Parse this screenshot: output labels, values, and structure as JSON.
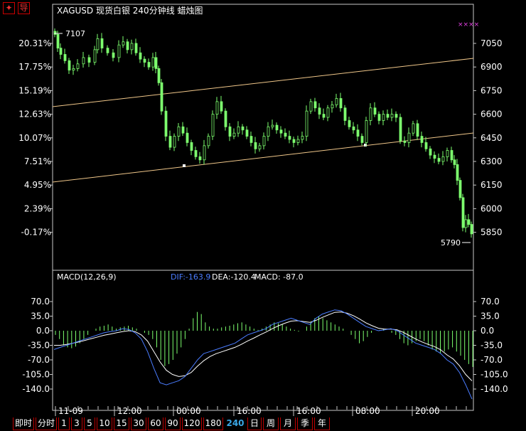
{
  "toolbar": {
    "btn1_glyph": "✦",
    "btn2_label": "导"
  },
  "header": {
    "title": "XAGUSD 现货白银 240分钟线  蜡烛图"
  },
  "main_chart": {
    "left_ticks": [
      "20.31%",
      "17.75%",
      "15.19%",
      "12.63%",
      "10.07%",
      "7.51%",
      "4.95%",
      "2.39%",
      "-0.17%"
    ],
    "right_ticks": [
      "7050",
      "6900",
      "6750",
      "6600",
      "6450",
      "6300",
      "6150",
      "6000",
      "5850"
    ],
    "high_label": "7107",
    "low_label": "5790",
    "corner_mark": "××××",
    "colors": {
      "candle": "#7dff6e",
      "channel": "#f0c78a",
      "grid": "#ffffff"
    }
  },
  "macd": {
    "title": "MACD(12,26,9)",
    "dif_label": "DIF:-163.9",
    "dea_label": "DEA:-120.4",
    "macd_label": "MACD: -87.0",
    "ticks": [
      "70.0",
      "35.0",
      "0.0",
      "-35.0",
      "-70.0",
      "-105.0",
      "-140.0"
    ],
    "colors": {
      "dif": "#4a7cff",
      "dea": "#ffffff",
      "bars": "#7dff6e"
    }
  },
  "x_axis": {
    "labels": [
      "11-09",
      "12:00",
      "00:00",
      "16:00",
      "16:00",
      "08:00",
      "20:00"
    ]
  },
  "tabs": [
    {
      "label": "即时"
    },
    {
      "label": "分时"
    },
    {
      "label": "1"
    },
    {
      "label": "3"
    },
    {
      "label": "5"
    },
    {
      "label": "10"
    },
    {
      "label": "15"
    },
    {
      "label": "30"
    },
    {
      "label": "60"
    },
    {
      "label": "90"
    },
    {
      "label": "120"
    },
    {
      "label": "180"
    },
    {
      "label": "240"
    },
    {
      "label": "日"
    },
    {
      "label": "周"
    },
    {
      "label": "月"
    },
    {
      "label": "季"
    },
    {
      "label": "年"
    }
  ],
  "active_tab": "240"
}
